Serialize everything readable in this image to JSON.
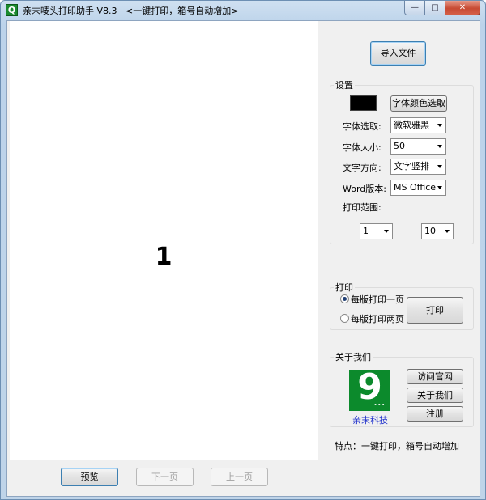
{
  "window": {
    "title": "亲末唛头打印助手 V8.3   <一键打印，箱号自动增加>",
    "app_icon_glyph": "Q",
    "controls": {
      "minimize": "—",
      "maximize": "□",
      "close": "✕"
    }
  },
  "preview": {
    "page_number": "1"
  },
  "nav": {
    "preview": "预览",
    "next": "下一页",
    "prev": "上一页"
  },
  "import_button": "导入文件",
  "settings": {
    "title": "设置",
    "color_button": "字体颜色选取",
    "swatch_color": "#000000",
    "font_label": "字体选取:",
    "font_value": "微软雅黑",
    "size_label": "字体大小:",
    "size_value": "50",
    "direction_label": "文字方向:",
    "direction_value": "文字竖排",
    "word_label": "Word版本:",
    "word_value": "MS Office",
    "range_label": "打印范围:",
    "range_from": "1",
    "range_separator": "—",
    "range_to": "10"
  },
  "print": {
    "title": "打印",
    "option_one": "每版打印一页",
    "option_two": "每版打印两页",
    "selected": "option_one",
    "print_button": "打印"
  },
  "about": {
    "title": "关于我们",
    "logo_text": "9",
    "logo_dots": "...",
    "company": "亲末科技",
    "visit_button": "访问官网",
    "about_button": "关于我们",
    "register_button": "注册"
  },
  "features": "特点：一键打印，箱号自动增加",
  "colors": {
    "logo_green": "#0c8a2c",
    "company_text": "#2233cc"
  }
}
